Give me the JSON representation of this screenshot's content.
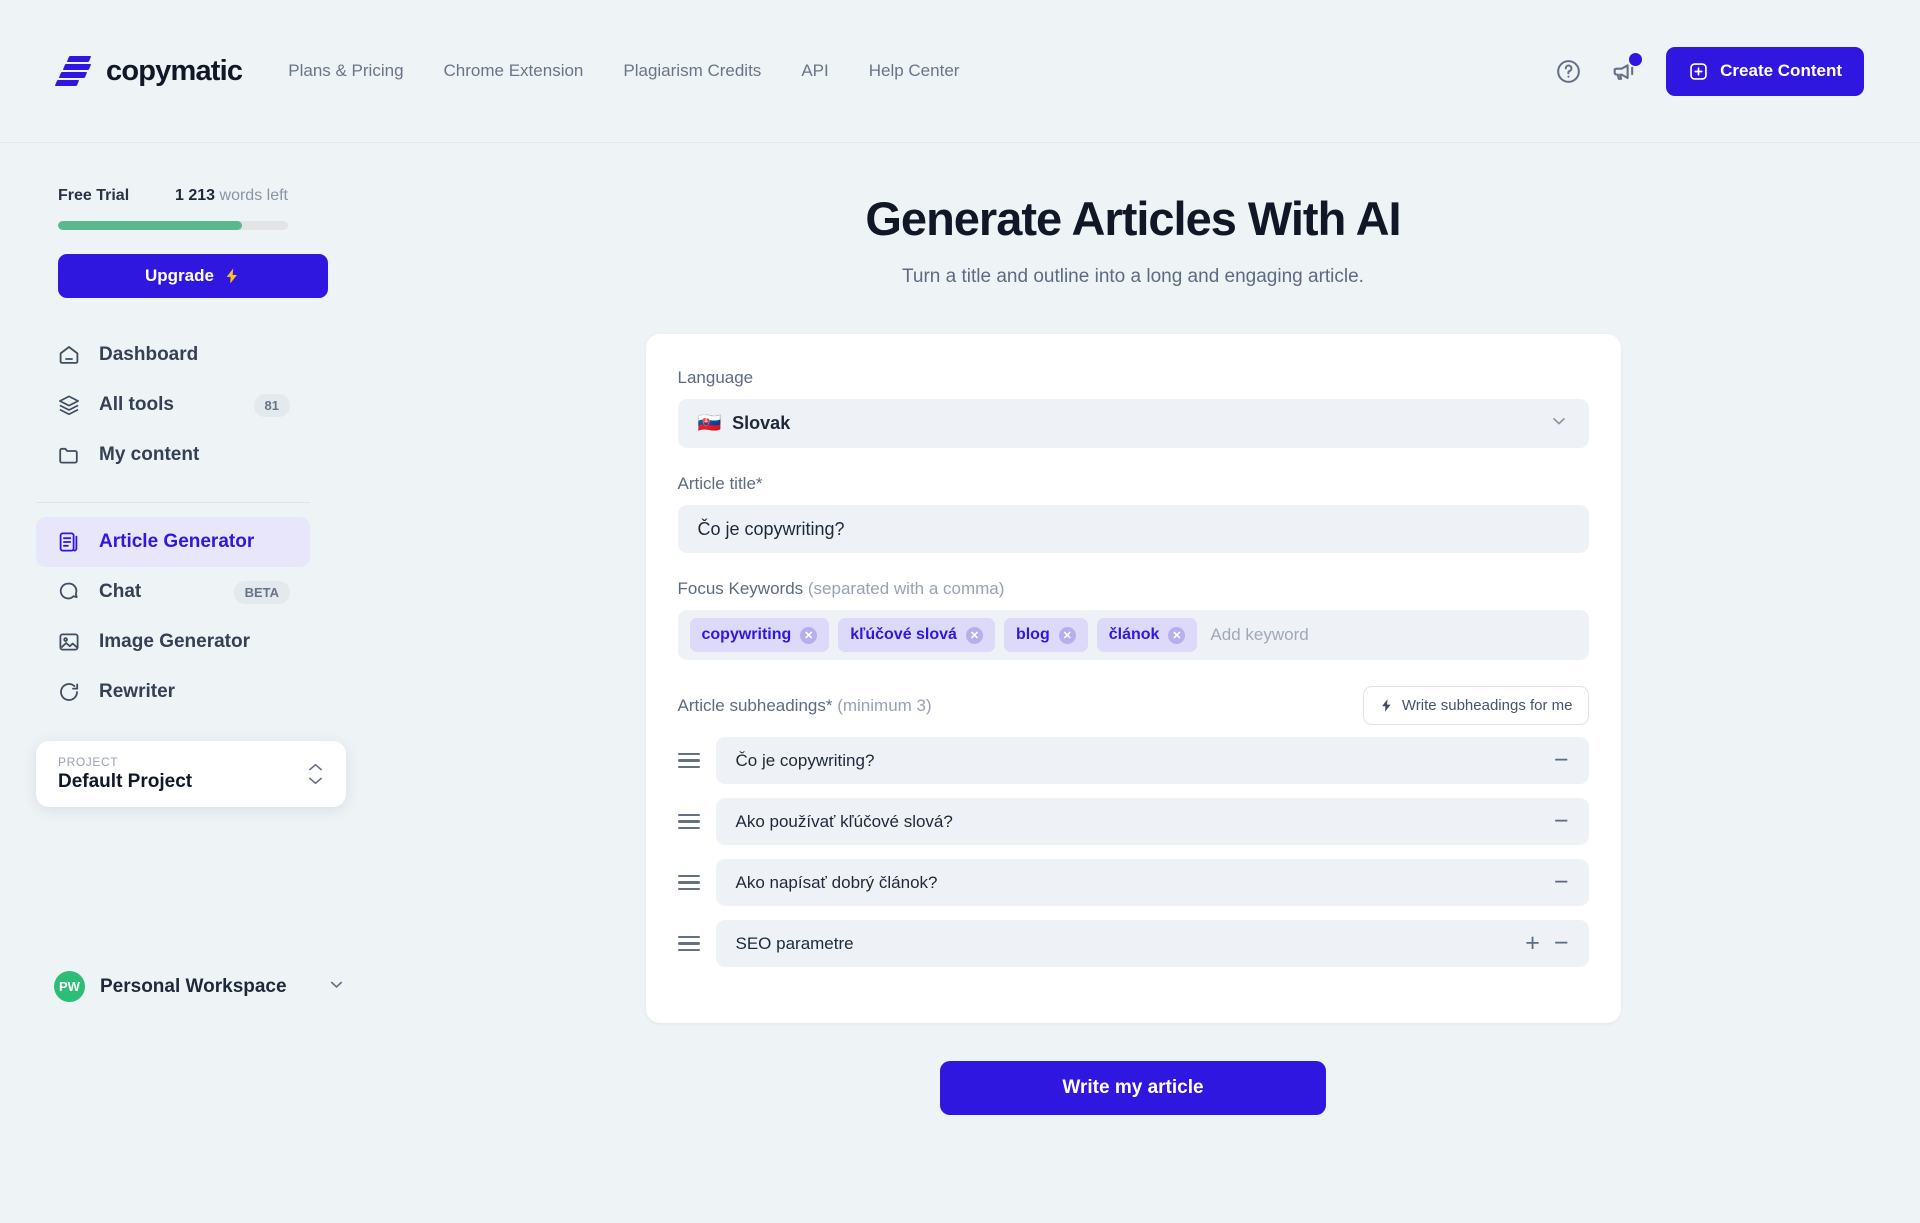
{
  "header": {
    "logo_text": "copymatic",
    "nav": [
      {
        "label": "Plans & Pricing"
      },
      {
        "label": "Chrome Extension"
      },
      {
        "label": "Plagiarism Credits"
      },
      {
        "label": "API"
      },
      {
        "label": "Help Center"
      }
    ],
    "help_icon": "question-circle-icon",
    "announcement_icon": "megaphone-icon",
    "create_button": "Create Content",
    "accent_color": "#3017e0"
  },
  "sidebar": {
    "trial_label": "Free Trial",
    "words_count": "1 213",
    "words_suffix": " words left",
    "progress_percent": 80,
    "progress_color": "#5ab98a",
    "upgrade_label": "Upgrade",
    "upgrade_icon": "lightning-bolt-icon",
    "nav_primary": [
      {
        "label": "Dashboard",
        "icon": "home-icon",
        "badge": ""
      },
      {
        "label": "All tools",
        "icon": "layers-icon",
        "badge": "81"
      },
      {
        "label": "My content",
        "icon": "folder-icon",
        "badge": ""
      }
    ],
    "nav_tools": [
      {
        "label": "Article Generator",
        "icon": "document-icon",
        "badge": "",
        "active": true
      },
      {
        "label": "Chat",
        "icon": "chat-bubble-icon",
        "badge": "BETA",
        "active": false
      },
      {
        "label": "Image Generator",
        "icon": "image-icon",
        "badge": "",
        "active": false
      },
      {
        "label": "Rewriter",
        "icon": "refresh-icon",
        "badge": "",
        "active": false
      }
    ],
    "project": {
      "label": "PROJECT",
      "name": "Default Project",
      "chevron_icon": "chevron-up-down-icon"
    },
    "workspace": {
      "initials": "PW",
      "name": "Personal Workspace",
      "avatar_color": "#2dbd77",
      "chevron_icon": "chevron-down-icon"
    }
  },
  "main": {
    "title": "Generate Articles With AI",
    "subtitle": "Turn a title and outline into a long and engaging article.",
    "language": {
      "label": "Language",
      "flag": "🇸🇰",
      "value": "Slovak",
      "chevron_icon": "chevron-down-icon"
    },
    "article_title": {
      "label": "Article title*",
      "value": "Čo je copywriting?"
    },
    "keywords": {
      "label": "Focus Keywords",
      "label_hint": " (separated with a comma)",
      "chips": [
        "copywriting",
        "kľúčové slová",
        "blog",
        "článok"
      ],
      "placeholder": "Add keyword",
      "remove_icon": "close-circle-icon"
    },
    "subheadings": {
      "label": "Article subheadings*",
      "label_hint": " (minimum 3)",
      "ai_button": "Write subheadings for me",
      "ai_button_icon": "lightning-bolt-icon",
      "items": [
        {
          "value": "Čo je copywriting?",
          "has_add": false,
          "has_remove": true
        },
        {
          "value": "Ako používať kľúčové slová?",
          "has_add": false,
          "has_remove": true
        },
        {
          "value": "Ako napísať dobrý článok?",
          "has_add": false,
          "has_remove": true
        },
        {
          "value": "SEO parametre",
          "has_add": true,
          "has_remove": true
        }
      ],
      "add_label": "+",
      "remove_label": "−",
      "drag_icon": "drag-handle-icon"
    },
    "submit_label": "Write my article"
  }
}
